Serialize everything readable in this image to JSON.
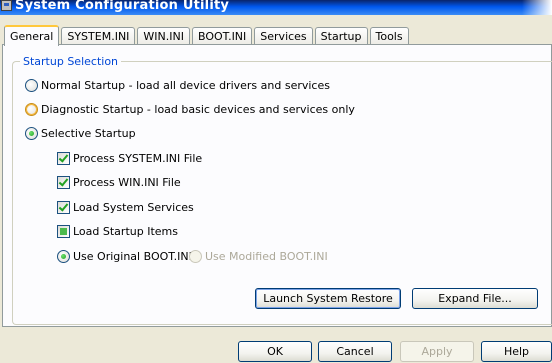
{
  "window": {
    "title": "System Configuration Utility"
  },
  "tabs": [
    {
      "label": "General",
      "active": true
    },
    {
      "label": "SYSTEM.INI"
    },
    {
      "label": "WIN.INI"
    },
    {
      "label": "BOOT.INI"
    },
    {
      "label": "Services"
    },
    {
      "label": "Startup"
    },
    {
      "label": "Tools"
    }
  ],
  "startup_selection": {
    "title": "Startup Selection",
    "normal": {
      "label": "Normal Startup - load all device drivers and services",
      "selected": false
    },
    "diagnostic": {
      "label": "Diagnostic Startup - load basic devices and services only",
      "selected": false
    },
    "selective": {
      "label": "Selective Startup",
      "selected": true
    },
    "options": [
      {
        "label": "Process SYSTEM.INI File",
        "state": "checked"
      },
      {
        "label": "Process WIN.INI File",
        "state": "checked"
      },
      {
        "label": "Load System Services",
        "state": "checked"
      },
      {
        "label": "Load Startup Items",
        "state": "indeterminate"
      }
    ],
    "boot_original": {
      "label": "Use Original BOOT.INI",
      "selected": true
    },
    "boot_modified": {
      "label": "Use Modified BOOT.INI",
      "selected": false,
      "enabled": false
    }
  },
  "actions": {
    "launch_restore": "Launch System Restore",
    "expand_file": "Expand File..."
  },
  "dialog_buttons": {
    "ok": "OK",
    "cancel": "Cancel",
    "apply": "Apply",
    "help": "Help"
  },
  "colors": {
    "title_bar": "#0058ee",
    "group_title": "#0046d5",
    "active_tab_accent": "#ffc83c",
    "check_mark": "#21a121"
  }
}
